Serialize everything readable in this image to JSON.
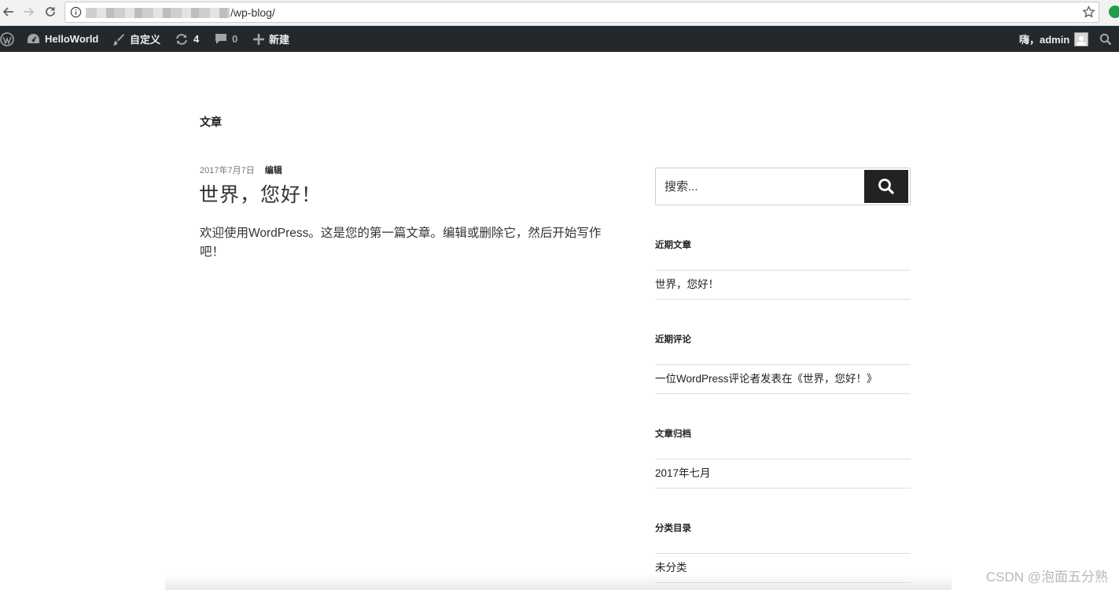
{
  "browser": {
    "url_path": "/wp-blog/"
  },
  "adminbar": {
    "site_name": "HelloWorld",
    "customize": "自定义",
    "updates_count": "4",
    "comments_count": "0",
    "new_label": "新建",
    "greeting": "嗨，admin"
  },
  "page": {
    "label": "文章"
  },
  "post": {
    "date": "2017年7月7日",
    "edit_label": "编辑",
    "title": "世界，您好！",
    "body": "欢迎使用WordPress。这是您的第一篇文章。编辑或删除它，然后开始写作吧！"
  },
  "sidebar": {
    "search_placeholder": "搜索...",
    "recent_posts": {
      "title": "近期文章",
      "items": [
        "世界，您好！"
      ]
    },
    "recent_comments": {
      "title": "近期评论",
      "items": [
        "一位WordPress评论者发表在《世界，您好！》"
      ]
    },
    "archives": {
      "title": "文章归档",
      "items": [
        "2017年七月"
      ]
    },
    "categories": {
      "title": "分类目录",
      "items": [
        "未分类"
      ]
    }
  },
  "watermark": "CSDN @泡面五分熟",
  "colors": {
    "adminbar_bg": "#23282d",
    "search_button_bg": "#222222"
  }
}
